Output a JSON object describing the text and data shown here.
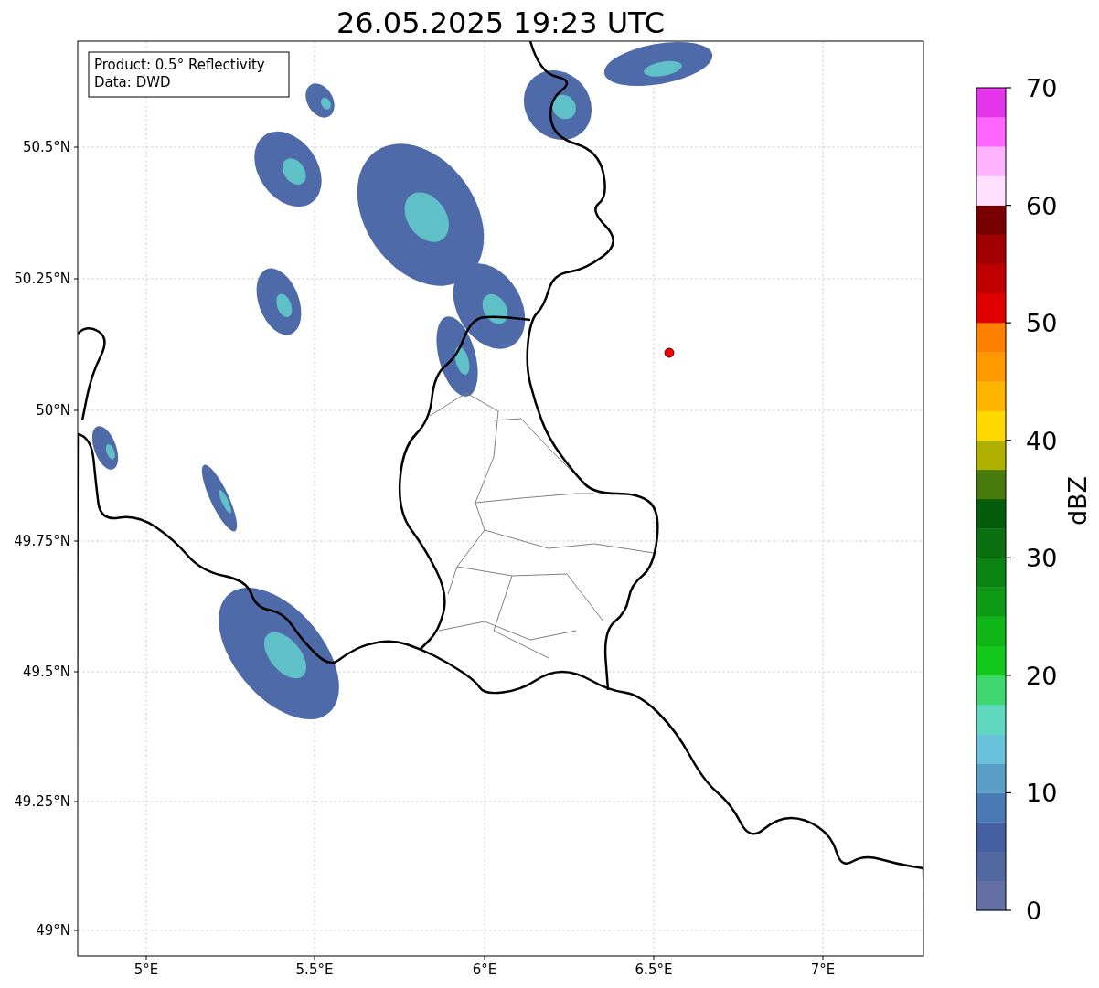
{
  "title": "26.05.2025 19:23 UTC",
  "legend": {
    "lines": [
      "Product: 0.5° Reflectivity",
      "Data: DWD"
    ]
  },
  "map": {
    "x_ticks": [
      "5°E",
      "5.5°E",
      "6°E",
      "6.5°E",
      "7°E"
    ],
    "y_ticks": [
      "50.5°N",
      "50.25°N",
      "50°N",
      "49.75°N",
      "49.5°N",
      "49.25°N",
      "49°N"
    ]
  },
  "colorbar": {
    "label": "dBZ",
    "ticks": [
      "70",
      "60",
      "50",
      "40",
      "30",
      "20",
      "10",
      "0"
    ],
    "segments": [
      {
        "color": "#6470a4"
      },
      {
        "color": "#5268a0"
      },
      {
        "color": "#4460a0"
      },
      {
        "color": "#4a7ab4"
      },
      {
        "color": "#5a9ec8"
      },
      {
        "color": "#68c2dc"
      },
      {
        "color": "#60d8c0"
      },
      {
        "color": "#3ed66e"
      },
      {
        "color": "#12c81a"
      },
      {
        "color": "#10b618"
      },
      {
        "color": "#0d9a14"
      },
      {
        "color": "#0a8214"
      },
      {
        "color": "#0a7010"
      },
      {
        "color": "#055c0a"
      },
      {
        "color": "#467a0a"
      },
      {
        "color": "#b0b000"
      },
      {
        "color": "#ffd800"
      },
      {
        "color": "#ffb400"
      },
      {
        "color": "#ff9900"
      },
      {
        "color": "#ff7f00"
      },
      {
        "color": "#e00000"
      },
      {
        "color": "#c00000"
      },
      {
        "color": "#a00000"
      },
      {
        "color": "#780000"
      },
      {
        "color": "#ffe0ff"
      },
      {
        "color": "#ffb3ff"
      },
      {
        "color": "#ff66ff"
      },
      {
        "color": "#e535eb"
      }
    ]
  }
}
